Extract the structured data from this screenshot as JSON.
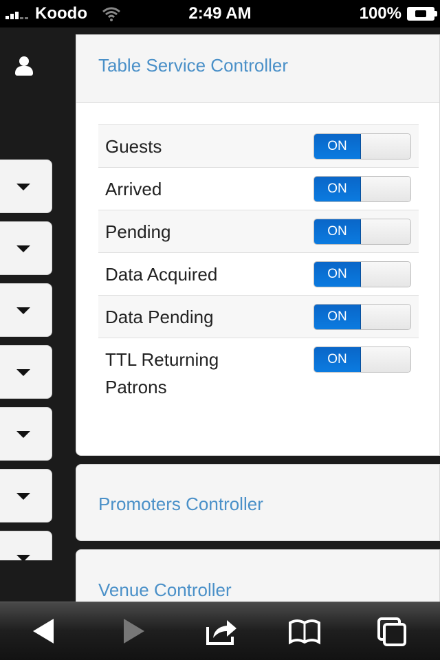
{
  "status_bar": {
    "carrier": "Koodo",
    "time": "2:49 AM",
    "battery": "100%"
  },
  "sidebar": {
    "user_icon": "user-icon",
    "dropdown_count": 7
  },
  "panels": {
    "table_service": {
      "title": "Table Service Controller",
      "rows": [
        {
          "label": "Guests",
          "toggle": "ON"
        },
        {
          "label": "Arrived",
          "toggle": "ON"
        },
        {
          "label": "Pending",
          "toggle": "ON"
        },
        {
          "label": "Data Acquired",
          "toggle": "ON"
        },
        {
          "label": "Data Pending",
          "toggle": "ON"
        },
        {
          "label": "TTL Returning Patrons",
          "toggle": "ON"
        }
      ]
    },
    "promoters": {
      "title": "Promoters Controller"
    },
    "venue": {
      "title": "Venue Controller"
    }
  },
  "toolbar": {
    "icons": [
      "back-arrow-icon",
      "forward-arrow-icon",
      "share-icon",
      "bookmarks-icon",
      "tabs-icon"
    ]
  },
  "colors": {
    "accent_link": "#4a90c8",
    "toggle_on": "#0a66c8",
    "sidebar_bg": "#1b1b1b"
  }
}
